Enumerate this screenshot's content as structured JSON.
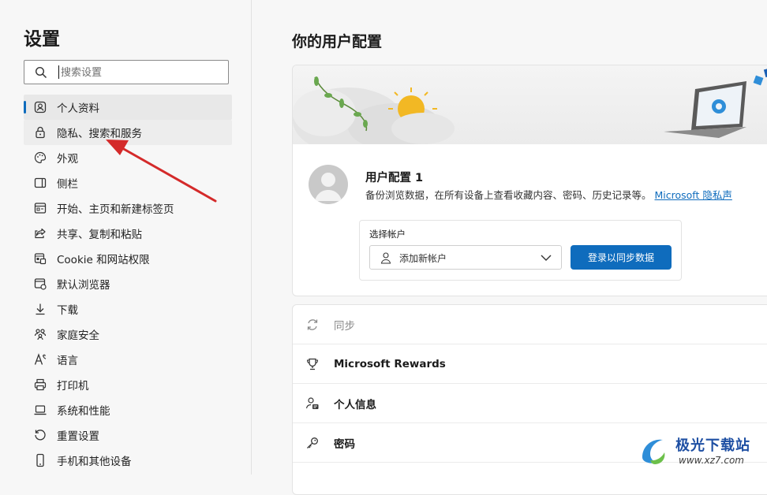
{
  "sidebar": {
    "title": "设置",
    "search_placeholder": "搜索设置",
    "items": [
      {
        "label": "个人资料",
        "icon": "profile-icon"
      },
      {
        "label": "隐私、搜索和服务",
        "icon": "lock-icon"
      },
      {
        "label": "外观",
        "icon": "palette-icon"
      },
      {
        "label": "侧栏",
        "icon": "sidebar-icon"
      },
      {
        "label": "开始、主页和新建标签页",
        "icon": "home-icon"
      },
      {
        "label": "共享、复制和粘贴",
        "icon": "share-icon"
      },
      {
        "label": "Cookie 和网站权限",
        "icon": "cookie-icon"
      },
      {
        "label": "默认浏览器",
        "icon": "browser-icon"
      },
      {
        "label": "下载",
        "icon": "download-icon"
      },
      {
        "label": "家庭安全",
        "icon": "family-icon"
      },
      {
        "label": "语言",
        "icon": "language-icon"
      },
      {
        "label": "打印机",
        "icon": "printer-icon"
      },
      {
        "label": "系统和性能",
        "icon": "laptop-icon"
      },
      {
        "label": "重置设置",
        "icon": "reset-icon"
      },
      {
        "label": "手机和其他设备",
        "icon": "phone-icon"
      }
    ]
  },
  "main": {
    "title": "你的用户配置",
    "profile": {
      "name": "用户配置 1",
      "description": "备份浏览数据，在所有设备上查看收藏内容、密码、历史记录等。",
      "link": "Microsoft 隐私声"
    },
    "account": {
      "label": "选择帐户",
      "selected": "添加新帐户",
      "signin_button": "登录以同步数据"
    },
    "rows": [
      {
        "label": "同步",
        "icon": "sync-icon",
        "muted": true
      },
      {
        "label": "Microsoft Rewards",
        "icon": "trophy-icon"
      },
      {
        "label": "个人信息",
        "icon": "personal-info-icon"
      },
      {
        "label": "密码",
        "icon": "key-icon"
      }
    ]
  },
  "watermark": {
    "name": "极光下载站",
    "url": "www.xz7.com"
  },
  "colors": {
    "accent": "#0f6cbd",
    "annotation_arrow": "#d42a2a"
  }
}
